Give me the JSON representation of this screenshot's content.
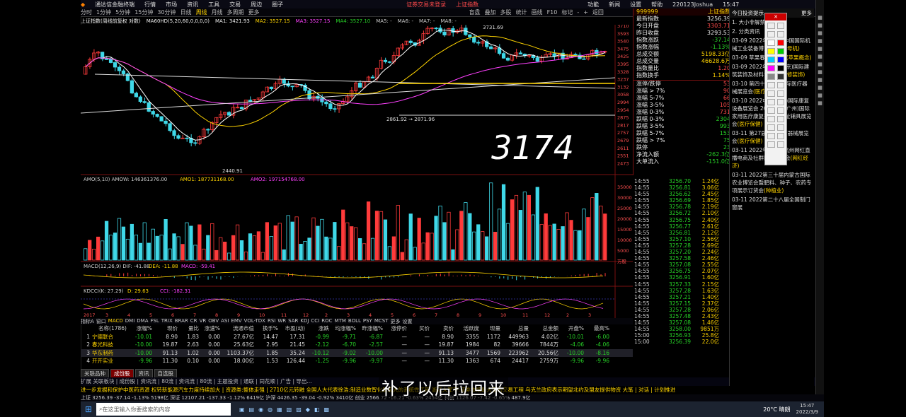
{
  "app": {
    "title": "通达信金融终端",
    "login_status": "证券交易未登录",
    "login_link": "上证指数",
    "user": "220123Joshua",
    "clock": "15:47"
  },
  "menu": [
    "行情",
    "市场",
    "资讯",
    "工具",
    "交易",
    "周边",
    "圈子"
  ],
  "right_menu": [
    "功能",
    "新闻",
    "设置",
    "帮助",
    "客服"
  ],
  "period_tabs": [
    "分时",
    "1分钟",
    "5分钟",
    "15分钟",
    "30分钟",
    "日线",
    "周线",
    "月线",
    "多周期",
    "更多"
  ],
  "active_period": "周线",
  "right_tools": [
    "盲盘",
    "叠加",
    "多股",
    "统计",
    "画线",
    "F10",
    "标记",
    "-",
    "+",
    "返回"
  ],
  "info_line": [
    "上证指数(周线前复权 对数)",
    "MA60HD(5,20,60,0,0,0,0)",
    "MA1: 3421.93",
    "MA2: 3527.15",
    "MA3: 3527.15",
    "MA4: 3527.10",
    "MA5: -",
    "MA6: -",
    "MA7: -",
    "MA8: -"
  ],
  "chart_labels": {
    "high": "3731.69",
    "range_label": "2861.92 → 2871.96",
    "low": "2440.91",
    "handwriting": "3174"
  },
  "price_axis": [
    "3710",
    "3593",
    "3540",
    "3475",
    "3425",
    "3395",
    "3328",
    "3237",
    "3132",
    "3058",
    "2994",
    "2954",
    "2875",
    "2817",
    "2757",
    "2679",
    "2611",
    "2551",
    "2473"
  ],
  "volume_axis": [
    "35000",
    "30000",
    "25000",
    "20000",
    "15000",
    "10000",
    "5000",
    "万股"
  ],
  "indicator_labels": {
    "amo": "AMO(5,10) AMOW: 146361376.00",
    "amo1": "AMO1: 187731168.00",
    "amo2": "AMO2: 197154768.00",
    "macd": "MACD(12,26,9) DIF: -41.88",
    "dea": "DEA: -11.88",
    "macdv": "MACD: -59.41",
    "kdcci": "KDCCI(K: 27.29)",
    "kd": "D: 29.63",
    "cci": "CCI: -182.31"
  },
  "x_labels": [
    "2017",
    "3",
    "4",
    "5",
    "6",
    "7",
    "8",
    "9",
    "10",
    "11",
    "12",
    "2",
    "3",
    "4",
    "5",
    "6",
    "7",
    "8",
    "9",
    "10",
    "11",
    "12",
    "2",
    "3"
  ],
  "indicator_tabs": [
    "指标A",
    "窗口",
    "MACD",
    "DMI",
    "DMA",
    "FSL",
    "TRIX",
    "BRAR",
    "CR",
    "VR",
    "OBV",
    "ASI",
    "EMV",
    "VOL-TDX",
    "RSI",
    "WR",
    "SAR",
    "KDJ",
    "CCI",
    "ROC",
    "MTM",
    "BOLL",
    "PSY",
    "MCST",
    "更多",
    "设置"
  ],
  "index_panel": {
    "code": "999999",
    "name": "上证指数",
    "rows": [
      {
        "label": "最新指数",
        "value": "3256.39",
        "c": "white"
      },
      {
        "label": "今日开盘",
        "value": "3303.71",
        "c": "red"
      },
      {
        "label": "昨日收盘",
        "value": "3293.53",
        "c": "white"
      },
      {
        "label": "指数涨跌",
        "value": "-37.14",
        "c": "green"
      },
      {
        "label": "指数涨幅",
        "value": "-1.13%",
        "c": "green"
      },
      {
        "label": "总成交额",
        "value": "5198.33亿",
        "c": "yellow"
      },
      {
        "label": "总成交量",
        "value": "46628.6万",
        "c": "yellow"
      },
      {
        "label": "指数量比",
        "value": "1.20",
        "c": "red"
      },
      {
        "label": "指数换手",
        "value": "1.14%",
        "c": "yellow"
      }
    ],
    "dist": [
      {
        "label": "涨停/跌停",
        "value": "53",
        "c": "red"
      },
      {
        "label": "涨幅 > 7%",
        "value": "90",
        "c": "red"
      },
      {
        "label": "涨幅 5-7%",
        "value": "66",
        "c": "red"
      },
      {
        "label": "涨幅 3-5%",
        "value": "105",
        "c": "red"
      },
      {
        "label": "涨幅 0-3%",
        "value": "731",
        "c": "red"
      },
      {
        "label": "跌幅 0-3%",
        "value": "2304",
        "c": "green"
      },
      {
        "label": "跌幅 3-5%",
        "value": "993",
        "c": "green"
      },
      {
        "label": "跌幅 5-7%",
        "value": "153",
        "c": "green"
      },
      {
        "label": "跌幅 > 7%",
        "value": "75",
        "c": "green"
      },
      {
        "label": "跌停",
        "value": "23",
        "c": "green"
      },
      {
        "label": "净流入额",
        "value": "-262.3亿",
        "c": "green"
      },
      {
        "label": "大单流入",
        "value": "-151.0亿",
        "c": "green"
      }
    ]
  },
  "ticks": [
    [
      "14:55",
      "3256.70",
      "1.24亿"
    ],
    [
      "14:55",
      "3256.81",
      "3.06亿"
    ],
    [
      "14:55",
      "3256.62",
      "2.45亿"
    ],
    [
      "14:55",
      "3256.69",
      "1.85亿"
    ],
    [
      "14:55",
      "3256.78",
      "2.19亿"
    ],
    [
      "14:55",
      "3256.72",
      "2.10亿"
    ],
    [
      "14:55",
      "3256.75",
      "2.40亿"
    ],
    [
      "14:55",
      "3256.77",
      "2.61亿"
    ],
    [
      "14:55",
      "3256.81",
      "2.12亿"
    ],
    [
      "14:55",
      "3257.10",
      "2.56亿"
    ],
    [
      "14:55",
      "3257.28",
      "2.69亿"
    ],
    [
      "14:55",
      "3257.20",
      "2.24亿"
    ],
    [
      "14:55",
      "3257.58",
      "2.46亿"
    ],
    [
      "14:55",
      "3257.08",
      "2.55亿"
    ],
    [
      "14:55",
      "3256.75",
      "2.07亿"
    ],
    [
      "14:55",
      "3256.91",
      "1.60亿"
    ],
    [
      "14:55",
      "3257.33",
      "2.15亿"
    ],
    [
      "14:55",
      "3257.28",
      "1.63亿"
    ],
    [
      "14:55",
      "3257.21",
      "1.40亿"
    ],
    [
      "14:55",
      "3257.15",
      "2.37亿"
    ],
    [
      "14:55",
      "3257.28",
      "2.06亿"
    ],
    [
      "14:55",
      "3257.48",
      "2.43亿"
    ],
    [
      "14:55",
      "3257.08",
      "1.46亿"
    ],
    [
      "14:55",
      "3258.00",
      "9851万"
    ],
    [
      "15:00",
      "3256.93",
      "25.8亿"
    ],
    [
      "15:00",
      "3256.39",
      "22.0亿"
    ]
  ],
  "news_header": [
    "今日投资提示",
    "更多"
  ],
  "news": [
    {
      "t": "1. 大小非解禁"
    },
    {
      "t": "2. 分类资讯"
    },
    {
      "t": "03-09 2022年第六届中国国际机械工业装备博览会",
      "tag": "(工业母机)"
    },
    {
      "t": "03-09 苹果春季发布会",
      "tag": "(苹果概念)"
    },
    {
      "t": "03-09 2022年中国(北京)国际建筑装饰及材料博览会",
      "tag": "(装修装饰)"
    },
    {
      "t": "03-10 第四十届中国国际医疗器械展览会",
      "tag": "(医疗保健)"
    },
    {
      "t": "03-10 2022中国(广州)国际康复设备展览会 2022中国(广州)国际家用医疗康复护理及福祉辅具展览会",
      "tag": "(医疗保健)"
    },
    {
      "t": "03-11 第27届安徽医疗器械展览会",
      "tag": "(医疗保健)"
    },
    {
      "t": "03-11 2022年第十届杭州网红直播电商及社群团购博览会",
      "tag": "(网红经济)"
    },
    {
      "t": "03-11 2022第三十届内蒙古国际农业博览会暨肥料、种子、农药专项展示订货会",
      "tag": "(种植业)"
    },
    {
      "t": "03-11 2022第二十八届全国制门窗展"
    }
  ],
  "stock_table": {
    "headers": [
      "",
      "名称(1786)",
      "涨幅%",
      "现价",
      "量比",
      "涨速%",
      "流通市值",
      "换手%",
      "市盈(动)",
      "涨跌",
      "均涨幅%",
      "昨涨幅%",
      "涨停价",
      "买价",
      "卖价",
      "活跃度",
      "现量",
      "总量",
      "总金额",
      "开盘%",
      "最高%"
    ],
    "rows": [
      [
        "1",
        "宁德联合",
        "-10.01",
        "8.90",
        "1.83",
        "0.00",
        "27.67亿",
        "14.47",
        "17.31",
        "-0.99",
        "-9.71",
        "-6.87",
        "—",
        "—",
        "8.90",
        "3355",
        "1172",
        "449963",
        "4.02亿",
        "-10.01",
        "-6.00"
      ],
      [
        "2",
        "春光科技",
        "-10.00",
        "19.87",
        "2.63",
        "0.00",
        "25.63亿",
        "2.95",
        "21.45",
        "-2.12",
        "-6.70",
        "-2.57",
        "—",
        "—",
        "19.87",
        "1984",
        "82",
        "39666",
        "7844万",
        "-4.06",
        "-4.06"
      ],
      [
        "3",
        "华东制药",
        "-10.00",
        "91.13",
        "1.02",
        "0.00",
        "1103.37亿",
        "1.85",
        "35.24",
        "-10.12",
        "-9.02",
        "-10.00",
        "—",
        "—",
        "91.13",
        "3477",
        "1569",
        "223962",
        "20.56亿",
        "-10.00",
        "-8.16"
      ],
      [
        "4",
        "开开实业",
        "-9.96",
        "11.30",
        "0.10",
        "0.00",
        "18.00亿",
        "1.53",
        "126.44",
        "-1.25",
        "-9.96",
        "-9.97",
        "—",
        "—",
        "11.30",
        "1363",
        "674",
        "24417",
        "2759万",
        "-9.96",
        "-9.96"
      ]
    ]
  },
  "bottom_tabs": [
    "关联品种",
    "成份股",
    "资讯",
    "自选股"
  ],
  "status_text": "扩展 关联板块 | 成份股 | 资讯流 | 80流 | 资讯流 | 80流 | 主题投资 | 通联 | 同花顺 | 广告 | 导出...",
  "ticker_text": "进一步发掘和保护中医药资源   权转新能源汽车力度持续加大 | 资源类:整体走强 | 2710亿元转融   全国人大代表徐浩:制造业数智化是宏大的系统性工程   浙江大军平:证券市场是大型的交易工程   乌克兰政府表示期望北约及盟友提供物资   大笔 | 对话 | 计划推进",
  "index_bar": "上证 3256.39 -37.14 -1.13% 5198亿  深证 12107.21 -137.33 -1.12% 6419亿  沪深 4426.35 -39.04 -0.92% 3410亿  创业 2566.72 -16.21 -0.63% 2454亿  科创 1126.07 -7.42 -0.65% 487.9亿",
  "taskbar": {
    "search_placeholder": "在这里输入你要搜索的内容",
    "weather": "20°C 晴朗",
    "time": "15:47",
    "date": "2022/3/9"
  },
  "subtitle": "补了以后拉回来"
}
